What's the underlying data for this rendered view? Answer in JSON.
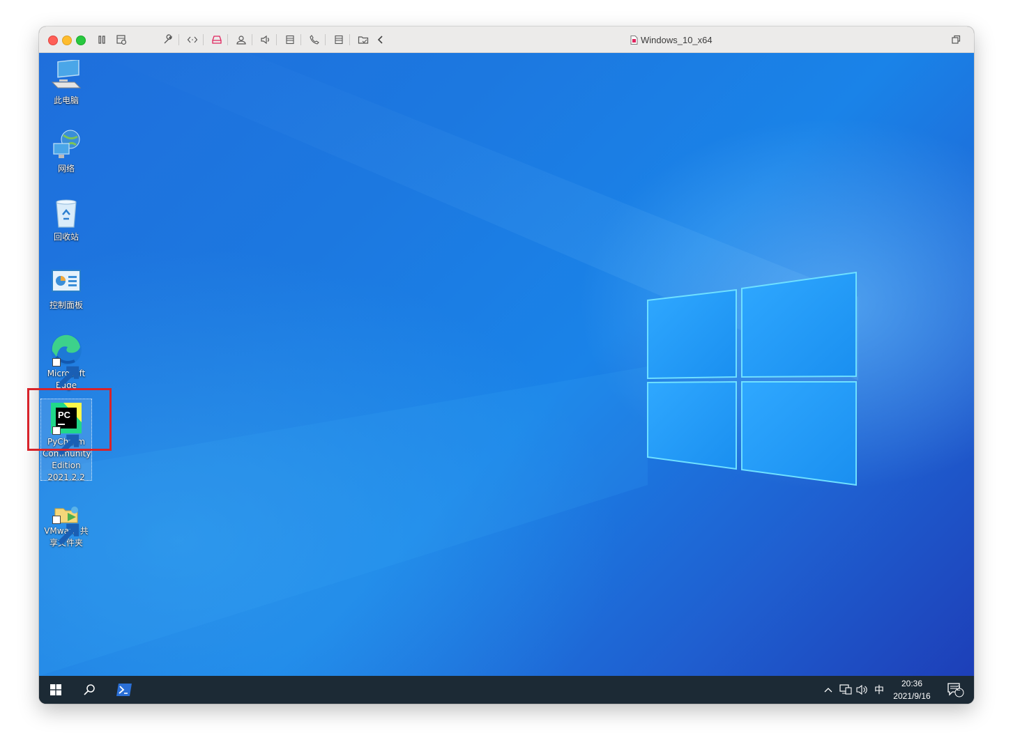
{
  "window": {
    "title": "Windows_10_x64",
    "controls": [
      "close",
      "minimize",
      "zoom"
    ],
    "toolbar_icons": [
      "pause-icon",
      "snapshot-icon",
      "settings-wrench-icon",
      "code-icon",
      "disk-icon",
      "user-icon",
      "volume-icon",
      "stack-icon",
      "phone-icon",
      "stack-icon",
      "folder-icon",
      "back-arrow-icon"
    ],
    "restore_icon": "restore-window-icon"
  },
  "desktop": {
    "icons": [
      {
        "label": "此电脑",
        "icon": "this-pc-icon",
        "shortcut": false
      },
      {
        "label": "网络",
        "icon": "network-icon",
        "shortcut": false
      },
      {
        "label": "回收站",
        "icon": "recycle-bin-icon",
        "shortcut": false
      },
      {
        "label": "控制面板",
        "icon": "control-panel-icon",
        "shortcut": false
      },
      {
        "label": "Microsoft Edge",
        "icon": "edge-icon",
        "shortcut": true
      },
      {
        "label": "PyCharm Community Edition 2021.2.2",
        "icon": "pycharm-icon",
        "shortcut": true,
        "selected": true
      },
      {
        "label": "VMware 共享文件夹",
        "icon": "vmware-shared-folder-icon",
        "shortcut": true
      }
    ],
    "highlight_color": "#d8232a"
  },
  "taskbar": {
    "start_icon": "windows-start-icon",
    "search_icon": "search-icon",
    "pinned_icon": "powershell-icon",
    "tray": {
      "chevron": "chevron-up-icon",
      "network": "network-tray-icon",
      "volume": "volume-tray-icon",
      "ime": "中",
      "time": "20:36",
      "date": "2021/9/16",
      "notifications": "2"
    }
  }
}
